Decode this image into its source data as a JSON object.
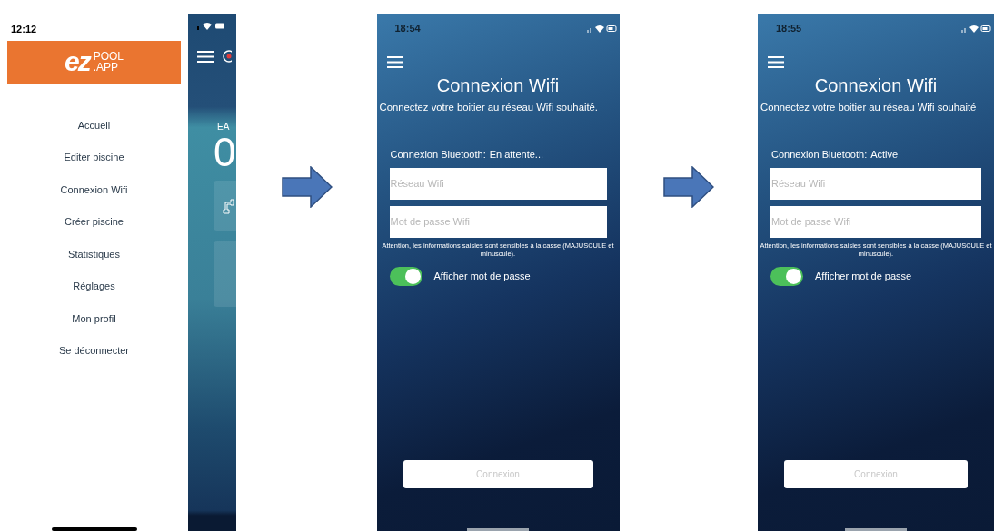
{
  "screens": [
    {
      "kind": "menu",
      "time": "12:12",
      "logo": {
        "mark": "ez",
        "line1": "POOL",
        "line2": ".APP"
      },
      "menu_items": [
        "Accueil",
        "Editer piscine",
        "Connexion Wifi",
        "Créer piscine",
        "Statistiques",
        "Réglages",
        "Mon profil",
        "Se déconnecter"
      ],
      "behind": {
        "label": "EA",
        "value": "0"
      }
    },
    {
      "kind": "wifi",
      "time": "18:54",
      "title": "Connexion Wifi",
      "subtitle": "Connectez votre boitier au réseau Wifi souhaité.",
      "bluetooth_label": "Connexion Bluetooth:",
      "bluetooth_status": "En attente...",
      "network_placeholder": "Réseau Wifi",
      "password_placeholder": "Mot de passe Wifi",
      "note": "Attention, les informations saisies sont sensibles à la casse (MAJUSCULE et minuscule).",
      "toggle": {
        "label": "Afficher mot de passe",
        "on": true
      },
      "button": {
        "label": "Connexion",
        "disabled": true
      }
    },
    {
      "kind": "wifi",
      "time": "18:55",
      "title": "Connexion Wifi",
      "subtitle": "Connectez votre boitier au réseau Wifi souhaité",
      "bluetooth_label": "Connexion Bluetooth:",
      "bluetooth_status": "Active",
      "network_placeholder": "Réseau Wifi",
      "password_placeholder": "Mot de passe Wifi",
      "note": "Attention, les informations saisies sont sensibles à la casse (MAJUSCULE et minuscule).",
      "toggle": {
        "label": "Afficher mot de passe",
        "on": true
      },
      "button": {
        "label": "Connexion",
        "disabled": true
      }
    }
  ]
}
